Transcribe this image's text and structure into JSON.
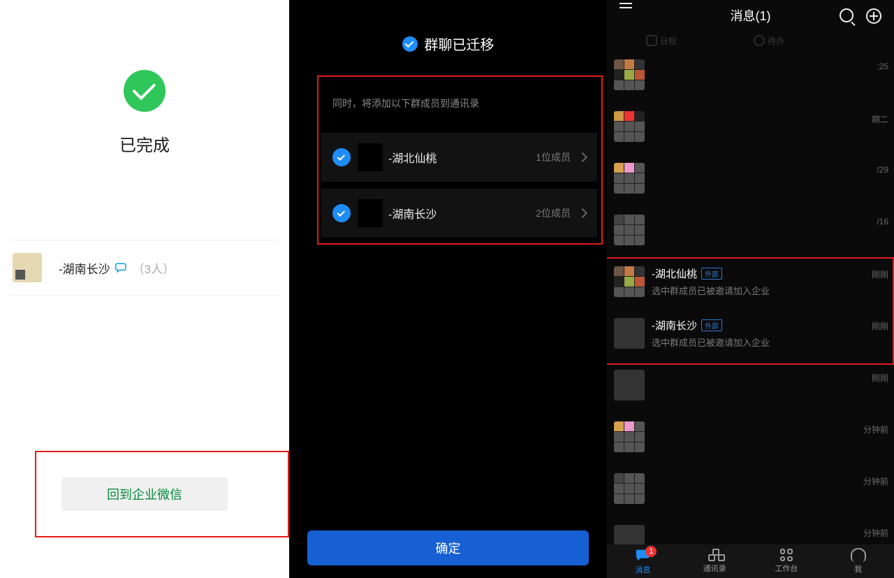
{
  "panel1": {
    "title": "已完成",
    "group_name": "-湖南长沙",
    "group_count": "（3人）",
    "back_button": "回到企业微信"
  },
  "panel2": {
    "header": "群聊已迁移",
    "hint": "同时，将添加以下群成员到通讯录",
    "items": [
      {
        "name": "-湖北仙桃",
        "count": "1位成员"
      },
      {
        "name": "-湖南长沙",
        "count": "2位成员"
      }
    ],
    "confirm": "确定"
  },
  "panel3": {
    "title": "消息(1)",
    "top_tabs": [
      "日程",
      "待办"
    ],
    "badge": "1",
    "chat_rows": [
      {
        "name": "",
        "sub": "",
        "time": ":25",
        "av": "a"
      },
      {
        "name": "",
        "sub": "",
        "time": "期二",
        "av": "b"
      },
      {
        "name": "",
        "sub": "",
        "time": "/29",
        "av": "c"
      },
      {
        "name": "",
        "sub": "",
        "time": "/16",
        "av": "d"
      },
      {
        "name": "-湖北仙桃",
        "sub": "选中群成员已被邀请加入企业",
        "time": "刚刚",
        "ext": true,
        "av": "a"
      },
      {
        "name": "-湖南长沙",
        "sub": "选中群成员已被邀请加入企业",
        "time": "刚刚",
        "ext": true,
        "av": "b",
        "single": true
      },
      {
        "name": "",
        "sub": "",
        "time": "刚刚",
        "single": true
      },
      {
        "name": "",
        "sub": "",
        "time": "分钟前",
        "av": "c"
      },
      {
        "name": "",
        "sub": "",
        "time": "分钟前",
        "av": "d"
      },
      {
        "name": "",
        "sub": "",
        "time": "分钟前",
        "single": true
      }
    ],
    "bottom_nav": [
      "消息",
      "通讯录",
      "工作台",
      "我"
    ],
    "ext_tag": "外部"
  }
}
